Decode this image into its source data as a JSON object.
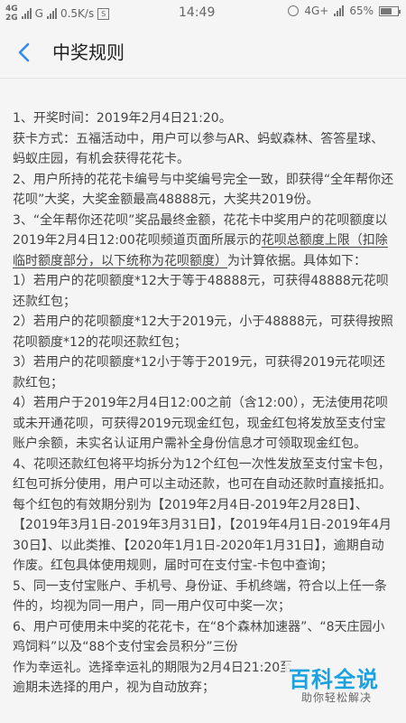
{
  "status_bar": {
    "net1": "4G",
    "net2": "2G",
    "carrier_icon": "G",
    "speed": "0.5K/s",
    "media_icon_label": "S",
    "time": "14:49",
    "net_right": "4G+",
    "battery": "65%",
    "battery_level": 0.65
  },
  "header": {
    "title": "中奖规则",
    "back_icon": "chevron-left-icon",
    "accent_color": "#2d8cf0"
  },
  "rules": {
    "p1": "1、开奖时间：2019年2月4日21:20。",
    "p2": "获卡方式：五福活动中，用户可以参与AR、蚂蚁森林、答答星球、蚂蚁庄园，有机会获得花花卡。",
    "p3": "2、用户所持的花花卡编号与中奖编号完全一致，即获得“全年帮你还花呗”大奖，大奖金额最高48888元，大奖共2019份。",
    "p4_a": "3、“全年帮你还花呗”奖品最终金额，花花卡中奖用户的花呗额度以2019年2月4日12:00花呗频道页面所展示的",
    "p4_b": "花呗总额度上限（扣除临时额度部分，以下统称为花呗额度）",
    "p4_c": "为计算依据。具体如下：",
    "p5": "1）若用户的花呗额度*12大于等于48888元，可获得48888元花呗还款红包；",
    "p6": "2）若用户的花呗额度*12大于2019元，小于48888元，可获得按照花呗额度*12的花呗还款红包；",
    "p7": "3）若用户的花呗额度*12小于等于2019元，可获得2019元花呗还款红包；",
    "p8": "4）若用户于2019年2月4日12:00之前（含12:00），无法使用花呗或未开通花呗，可获得2019元现金红包，现金红包将发放至支付宝账户余额，未实名认证用户需补全身份信息才可领取现金红包。",
    "p9": "4、花呗还款红包将平均拆分为12个红包一次性发放至支付宝卡包，红包可拆分使用，用户可以主动还款，也可在自动还款时直接抵扣。每个红包的有效期分别为【2019年2月4日-2019年2月28日】、【2019年3月1日-2019年3月31日】，【2019年4月1日-2019年4月30日】、以此类推、【2020年1月1日-2020年1月31日】，逾期自动作废。红包具体使用规则，届时可在支付宝-卡包中查询；",
    "p10": "5、同一支付宝账户、手机号、身份证、手机终端，符合以上任一条件的，均视为同一用户，同一用户仅可中奖一次；",
    "p11": "6、用户可使用未中奖的花花卡，在“8个森林加速器”、“8天庄园小鸡饲料”以及“88个支付宝会员积分”三份",
    "p12": "作为幸运礼。选择幸运礼的期限为2月4日21:20至",
    "p13": "逾期未选择的用户，视为自动放弃；"
  },
  "watermark": {
    "main": "百科全说",
    "sub": "助你轻松解决"
  }
}
